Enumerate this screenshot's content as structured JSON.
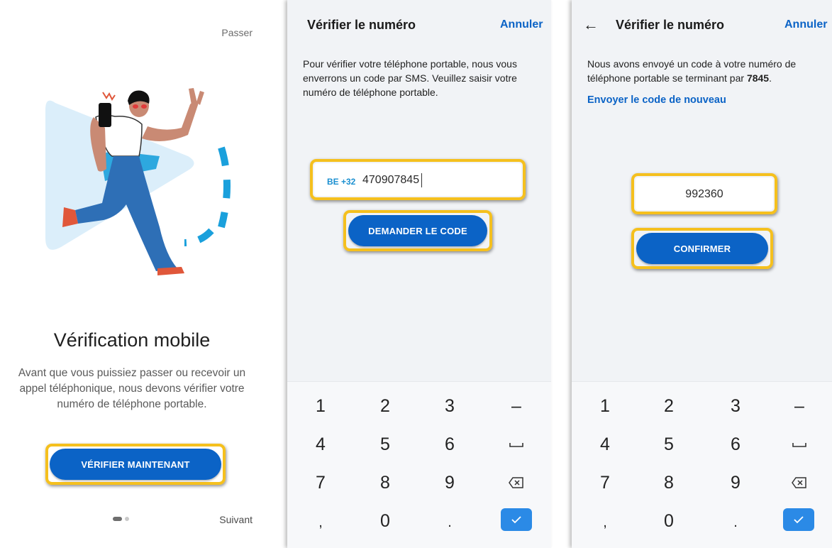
{
  "intro": {
    "skip_label": "Passer",
    "title": "Vérification mobile",
    "description": "Avant que vous puissiez passer ou recevoir un appel téléphonique, nous devons vérifier votre numéro de téléphone portable.",
    "verify_button": "VÉRIFIER MAINTENANT",
    "next_label": "Suivant",
    "page_indicator": {
      "current": 1,
      "total": 2
    },
    "illustration": "person-with-phone-peace-sign-illustration"
  },
  "verify_number": {
    "title": "Vérifier le numéro",
    "cancel_label": "Annuler",
    "instructions": "Pour vérifier votre téléphone portable, nous vous enverrons un code par SMS. Veuillez saisir votre numéro de téléphone portable.",
    "country_prefix": "BE +32",
    "phone_value": "470907845",
    "request_button": "DEMANDER LE CODE"
  },
  "enter_code": {
    "title": "Vérifier le numéro",
    "cancel_label": "Annuler",
    "instructions_text": "Nous avons envoyé un code à votre numéro de téléphone portable se terminant par",
    "phone_suffix": "7845",
    "resend_link": "Envoyer le code de nouveau",
    "code_value": "992360",
    "confirm_button": "CONFIRMER"
  },
  "keypad": {
    "keys": [
      "1",
      "2",
      "3",
      "–",
      "4",
      "5",
      "6",
      "space",
      "7",
      "8",
      "9",
      "backspace",
      ",",
      "0",
      ".",
      "done"
    ]
  },
  "colors": {
    "accent_blue": "#0b63c6",
    "highlight": "#f5c01e",
    "panel_bg": "#f1f3f6"
  }
}
